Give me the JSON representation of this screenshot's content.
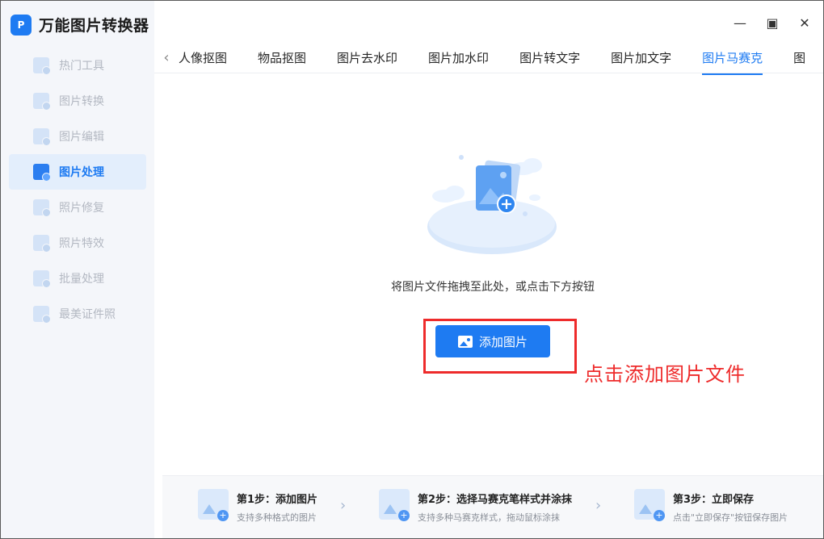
{
  "app": {
    "title": "万能图片转换器",
    "logo_text": "P"
  },
  "sidebar": {
    "items": [
      {
        "label": "热门工具",
        "icon": "grid-icon"
      },
      {
        "label": "图片转换",
        "icon": "image-convert-icon"
      },
      {
        "label": "图片编辑",
        "icon": "image-edit-icon"
      },
      {
        "label": "图片处理",
        "icon": "image-process-icon",
        "active": true
      },
      {
        "label": "照片修复",
        "icon": "photo-repair-icon"
      },
      {
        "label": "照片特效",
        "icon": "photo-effect-icon"
      },
      {
        "label": "批量处理",
        "icon": "batch-icon"
      },
      {
        "label": "最美证件照",
        "icon": "id-photo-icon"
      }
    ]
  },
  "window": {
    "minimize": "—",
    "maximize": "▣",
    "close": "✕"
  },
  "tabs": {
    "back": "‹",
    "items": [
      "人像抠图",
      "物品抠图",
      "图片去水印",
      "图片加水印",
      "图片转文字",
      "图片加文字",
      "图片马赛克",
      "图"
    ],
    "active_index": 6
  },
  "main": {
    "drop_hint": "将图片文件拖拽至此处，或点击下方按钮",
    "add_button": "添加图片",
    "annotation": "点击添加图片文件"
  },
  "steps": [
    {
      "title": "第1步：添加图片",
      "desc": "支持多种格式的图片"
    },
    {
      "title": "第2步：选择马赛克笔样式并涂抹",
      "desc": "支持多种马赛克样式，拖动鼠标涂抹"
    },
    {
      "title": "第3步：立即保存",
      "desc": "点击\"立即保存\"按钮保存图片"
    }
  ],
  "colors": {
    "accent": "#1e7bf2",
    "annotation_red": "#ee2b2b",
    "sidebar_bg": "#f4f6fa"
  }
}
